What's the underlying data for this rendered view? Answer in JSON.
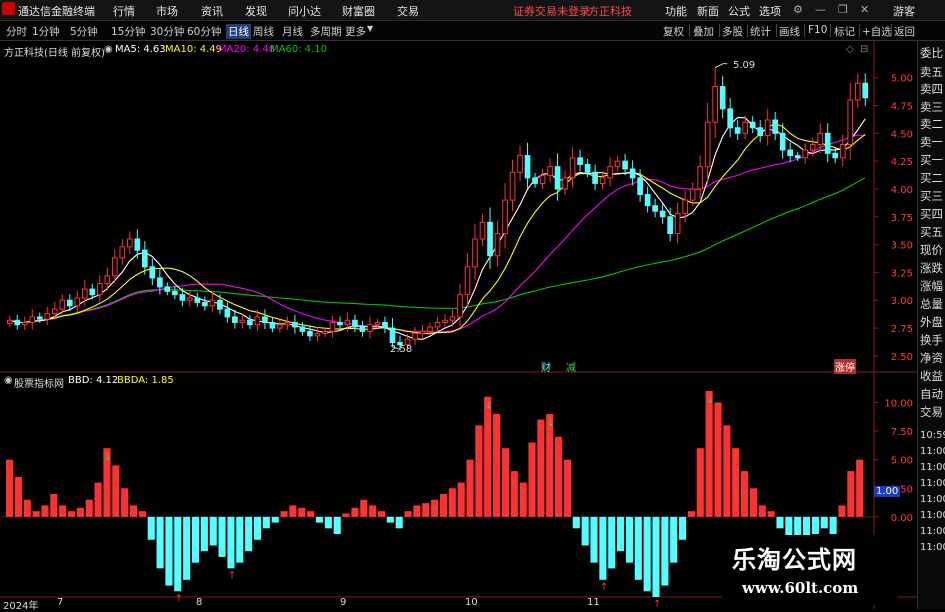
{
  "titlebar": {
    "app_name": "通达信金融终端",
    "menu": [
      "行情",
      "市场",
      "资讯",
      "发现",
      "问小达",
      "财富圈",
      "交易"
    ],
    "broker_notice": "证券交易未登录",
    "broker_name": "方正科技",
    "right_menu": [
      "功能",
      "新面",
      "公式",
      "选项"
    ],
    "guest": "游客"
  },
  "toolbar": {
    "periods": [
      "分时",
      "1分钟",
      "5分钟",
      "15分钟",
      "30分钟",
      "60分钟",
      "日线",
      "周线",
      "月线",
      "多周期",
      "更多"
    ],
    "active_period": "日线",
    "right_buttons": [
      "复权",
      "叠加",
      "多股",
      "统计",
      "画线",
      "F10",
      "标记",
      "+自选",
      "返回"
    ]
  },
  "main_legend": {
    "title": "方正科技(日线 前复权)",
    "ma5": "MA5: 4.63",
    "ma10": "MA10: 4.49",
    "ma20": "MA20: 4.48",
    "ma60": "MA60: 4.10"
  },
  "indicator_legend": {
    "title": "股票指标网",
    "bbd": "BBD: 4.12",
    "bbda": "BBDA: 1.85",
    "current_tag": "1.00"
  },
  "annotations": {
    "high": "5.09",
    "low": "2.58",
    "badge_cai": "财",
    "badge_jian": "减",
    "badge_rise": "涨停"
  },
  "date_axis": {
    "year": "2024年",
    "months": [
      "7",
      "8",
      "9",
      "10",
      "11"
    ]
  },
  "right_panel": {
    "vertical_labels": [
      "委比",
      "卖五",
      "卖四",
      "卖三",
      "卖二",
      "卖一",
      "买一",
      "买二",
      "买三",
      "买四",
      "买五",
      "现价",
      "涨跌",
      "涨幅",
      "总量",
      "外盘",
      "换手",
      "净资",
      "收益",
      "自动",
      "交易",
      "10:59",
      "11:00",
      "11:00",
      "11:00",
      "11:00",
      "11:00",
      "11:00",
      "11:00"
    ]
  },
  "colors": {
    "up": "#ff3232",
    "down": "#54ffff",
    "ma5": "#ffffff",
    "ma10": "#ffff00",
    "ma20": "#ff00ff",
    "ma60": "#00c800"
  },
  "chart_data": [
    {
      "type": "candlestick",
      "title": "方正科技(日线 前复权)",
      "x_months": [
        "7",
        "8",
        "9",
        "10",
        "11"
      ],
      "ylim": [
        2.4,
        5.15
      ],
      "ytick_labels": [
        "5.00",
        "4.75",
        "4.50",
        "4.25",
        "4.00",
        "3.75",
        "3.50",
        "3.25",
        "3.00",
        "2.75",
        "2.50"
      ],
      "close": [
        2.82,
        2.78,
        2.8,
        2.85,
        2.83,
        2.88,
        2.92,
        3.0,
        2.95,
        3.02,
        3.1,
        3.05,
        3.15,
        3.22,
        3.38,
        3.48,
        3.55,
        3.45,
        3.3,
        3.2,
        3.12,
        3.08,
        3.05,
        3.0,
        3.02,
        2.98,
        2.95,
        3.0,
        2.92,
        2.85,
        2.8,
        2.82,
        2.78,
        2.85,
        2.8,
        2.75,
        2.78,
        2.8,
        2.76,
        2.72,
        2.68,
        2.7,
        2.72,
        2.8,
        2.78,
        2.82,
        2.76,
        2.72,
        2.78,
        2.8,
        2.75,
        2.62,
        2.6,
        2.65,
        2.7,
        2.72,
        2.76,
        2.8,
        2.82,
        2.85,
        3.05,
        3.3,
        3.55,
        3.7,
        3.4,
        3.6,
        3.9,
        4.15,
        4.3,
        4.1,
        4.05,
        4.12,
        4.2,
        4.0,
        4.1,
        4.28,
        4.22,
        4.15,
        4.05,
        4.1,
        4.2,
        4.25,
        4.18,
        4.1,
        3.95,
        3.85,
        3.8,
        3.75,
        3.6,
        3.78,
        3.9,
        4.0,
        4.2,
        4.6,
        4.92,
        4.72,
        4.55,
        4.5,
        4.6,
        4.55,
        4.48,
        4.62,
        4.5,
        4.35,
        4.3,
        4.28,
        4.35,
        4.4,
        4.5,
        4.32,
        4.28,
        4.4,
        4.8,
        4.95,
        4.82
      ],
      "series": [
        {
          "name": "MA5",
          "last": 4.63
        },
        {
          "name": "MA10",
          "last": 4.49
        },
        {
          "name": "MA20",
          "last": 4.48
        },
        {
          "name": "MA60",
          "last": 4.1
        }
      ],
      "annotations": {
        "high": 5.09,
        "low": 2.58
      }
    },
    {
      "type": "bar",
      "title": "股票指标网",
      "ylim": [
        -7,
        11
      ],
      "ytick_labels": [
        "10.00",
        "7.50",
        "5.00",
        "2.50",
        "0.00"
      ],
      "values": [
        5.0,
        3.5,
        1.5,
        0.5,
        1.0,
        2.0,
        1.0,
        0.5,
        0.8,
        1.5,
        3.0,
        6.0,
        4.5,
        2.5,
        1.0,
        0.5,
        -2.0,
        -4.5,
        -6.0,
        -6.5,
        -5.5,
        -4.0,
        -3.0,
        -2.5,
        -3.5,
        -4.5,
        -4.0,
        -3.0,
        -2.0,
        -1.0,
        -0.5,
        0.5,
        1.0,
        0.8,
        0.5,
        -0.5,
        -1.0,
        -1.5,
        0.3,
        0.8,
        1.5,
        1.0,
        0.5,
        -0.5,
        -1.0,
        0.5,
        1.0,
        1.2,
        1.5,
        2.0,
        2.5,
        3.0,
        5.0,
        8.0,
        10.5,
        9.0,
        6.0,
        4.0,
        3.0,
        6.5,
        8.5,
        9.0,
        7.0,
        5.0,
        -1.0,
        -2.5,
        -4.0,
        -5.5,
        -4.5,
        -3.0,
        -4.0,
        -5.5,
        -6.5,
        -7.0,
        -6.0,
        -4.0,
        -2.0,
        0.5,
        6.0,
        11.0,
        10.0,
        8.0,
        6.0,
        4.0,
        2.5,
        1.0,
        0.5,
        -1.0,
        -2.0,
        -2.5,
        -2.0,
        -1.5,
        -1.0,
        -1.5,
        1.0,
        4.0,
        5.0
      ],
      "series": [
        {
          "name": "BBD",
          "last": 4.12
        },
        {
          "name": "BBDA",
          "last": 1.85
        }
      ]
    }
  ]
}
